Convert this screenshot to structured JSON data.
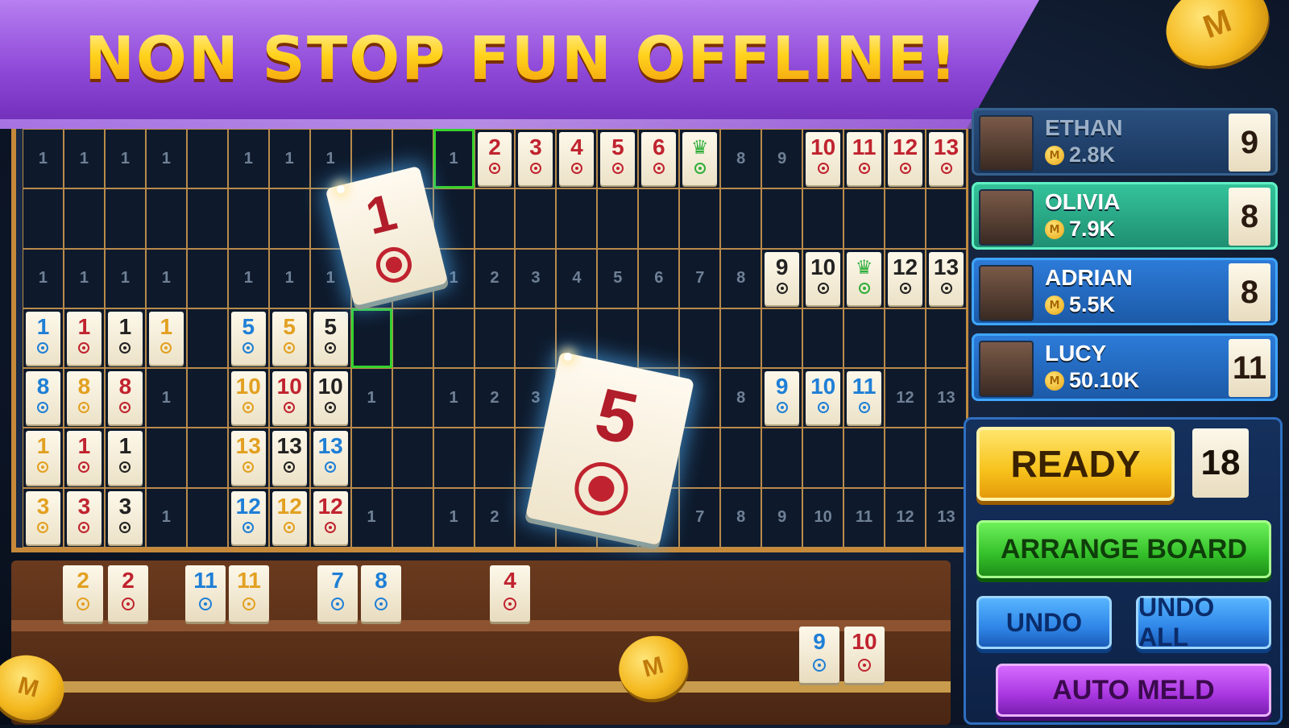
{
  "banner": {
    "title": "NON STOP FUN OFFLINE!"
  },
  "board": {
    "rows": [
      [
        {
          "n": "1",
          "t": "h"
        },
        {
          "n": "1",
          "t": "h"
        },
        {
          "n": "1",
          "t": "h"
        },
        {
          "n": "1",
          "t": "h"
        },
        {
          "n": "",
          "t": "e"
        },
        {
          "n": "1",
          "t": "h"
        },
        {
          "n": "1",
          "t": "h"
        },
        {
          "n": "1",
          "t": "h"
        },
        {
          "n": "",
          "t": "e"
        },
        {
          "n": "",
          "t": "e"
        },
        {
          "n": "1",
          "t": "h",
          "slot": true
        },
        {
          "n": "2",
          "t": "tile",
          "c": "red"
        },
        {
          "n": "3",
          "t": "tile",
          "c": "red"
        },
        {
          "n": "4",
          "t": "tile",
          "c": "red"
        },
        {
          "n": "5",
          "t": "tile",
          "c": "red"
        },
        {
          "n": "6",
          "t": "tile",
          "c": "red"
        },
        {
          "n": "joker",
          "t": "joker",
          "c": "green"
        },
        {
          "n": "8",
          "t": "h"
        },
        {
          "n": "9",
          "t": "h"
        },
        {
          "n": "10",
          "t": "tile",
          "c": "red"
        },
        {
          "n": "11",
          "t": "tile",
          "c": "red"
        },
        {
          "n": "12",
          "t": "tile",
          "c": "red"
        },
        {
          "n": "13",
          "t": "tile",
          "c": "red"
        }
      ],
      [
        {
          "n": "",
          "t": "e"
        },
        {
          "n": "",
          "t": "e"
        },
        {
          "n": "",
          "t": "e"
        },
        {
          "n": "",
          "t": "e"
        },
        {
          "n": "",
          "t": "e"
        },
        {
          "n": "",
          "t": "e"
        },
        {
          "n": "",
          "t": "e"
        },
        {
          "n": "",
          "t": "e"
        },
        {
          "n": "",
          "t": "e"
        },
        {
          "n": "",
          "t": "e"
        },
        {
          "n": "",
          "t": "e"
        },
        {
          "n": "",
          "t": "e"
        },
        {
          "n": "",
          "t": "e"
        },
        {
          "n": "",
          "t": "e"
        },
        {
          "n": "",
          "t": "e"
        },
        {
          "n": "",
          "t": "e"
        },
        {
          "n": "",
          "t": "e"
        },
        {
          "n": "",
          "t": "e"
        },
        {
          "n": "",
          "t": "e"
        },
        {
          "n": "",
          "t": "e"
        },
        {
          "n": "",
          "t": "e"
        },
        {
          "n": "",
          "t": "e"
        },
        {
          "n": "",
          "t": "e"
        }
      ],
      [
        {
          "n": "1",
          "t": "h"
        },
        {
          "n": "1",
          "t": "h"
        },
        {
          "n": "1",
          "t": "h"
        },
        {
          "n": "1",
          "t": "h"
        },
        {
          "n": "",
          "t": "e"
        },
        {
          "n": "1",
          "t": "h"
        },
        {
          "n": "1",
          "t": "h"
        },
        {
          "n": "1",
          "t": "h"
        },
        {
          "n": "",
          "t": "e"
        },
        {
          "n": "",
          "t": "e"
        },
        {
          "n": "1",
          "t": "h"
        },
        {
          "n": "2",
          "t": "h"
        },
        {
          "n": "3",
          "t": "h"
        },
        {
          "n": "4",
          "t": "h"
        },
        {
          "n": "5",
          "t": "h"
        },
        {
          "n": "6",
          "t": "h"
        },
        {
          "n": "7",
          "t": "h"
        },
        {
          "n": "8",
          "t": "h"
        },
        {
          "n": "9",
          "t": "tile",
          "c": "black"
        },
        {
          "n": "10",
          "t": "tile",
          "c": "black"
        },
        {
          "n": "joker",
          "t": "joker",
          "c": "green"
        },
        {
          "n": "12",
          "t": "tile",
          "c": "black"
        },
        {
          "n": "13",
          "t": "tile",
          "c": "black"
        }
      ],
      [
        {
          "n": "1",
          "t": "tile",
          "c": "blue"
        },
        {
          "n": "1",
          "t": "tile",
          "c": "red"
        },
        {
          "n": "1",
          "t": "tile",
          "c": "black"
        },
        {
          "n": "1",
          "t": "tile",
          "c": "yellow"
        },
        {
          "n": "",
          "t": "e"
        },
        {
          "n": "5",
          "t": "tile",
          "c": "blue"
        },
        {
          "n": "5",
          "t": "tile",
          "c": "yellow"
        },
        {
          "n": "5",
          "t": "tile",
          "c": "black"
        },
        {
          "n": "",
          "t": "e",
          "slot": true
        },
        {
          "n": "",
          "t": "e"
        },
        {
          "n": "",
          "t": "e"
        },
        {
          "n": "",
          "t": "e"
        },
        {
          "n": "",
          "t": "e"
        },
        {
          "n": "",
          "t": "e"
        },
        {
          "n": "",
          "t": "e"
        },
        {
          "n": "",
          "t": "e"
        },
        {
          "n": "",
          "t": "e"
        },
        {
          "n": "",
          "t": "e"
        },
        {
          "n": "",
          "t": "e"
        },
        {
          "n": "",
          "t": "e"
        },
        {
          "n": "",
          "t": "e"
        },
        {
          "n": "",
          "t": "e"
        },
        {
          "n": "",
          "t": "e"
        }
      ],
      [
        {
          "n": "8",
          "t": "tile",
          "c": "blue"
        },
        {
          "n": "8",
          "t": "tile",
          "c": "yellow"
        },
        {
          "n": "8",
          "t": "tile",
          "c": "red"
        },
        {
          "n": "1",
          "t": "h"
        },
        {
          "n": "",
          "t": "e"
        },
        {
          "n": "10",
          "t": "tile",
          "c": "yellow"
        },
        {
          "n": "10",
          "t": "tile",
          "c": "red"
        },
        {
          "n": "10",
          "t": "tile",
          "c": "black"
        },
        {
          "n": "1",
          "t": "h"
        },
        {
          "n": "",
          "t": "e"
        },
        {
          "n": "1",
          "t": "h"
        },
        {
          "n": "2",
          "t": "h"
        },
        {
          "n": "3",
          "t": "h"
        },
        {
          "n": "",
          "t": "e"
        },
        {
          "n": "",
          "t": "e"
        },
        {
          "n": "",
          "t": "e"
        },
        {
          "n": "",
          "t": "e"
        },
        {
          "n": "8",
          "t": "h"
        },
        {
          "n": "9",
          "t": "tile",
          "c": "blue"
        },
        {
          "n": "10",
          "t": "tile",
          "c": "blue"
        },
        {
          "n": "11",
          "t": "tile",
          "c": "blue"
        },
        {
          "n": "12",
          "t": "h"
        },
        {
          "n": "13",
          "t": "h"
        }
      ],
      [
        {
          "n": "1",
          "t": "tile",
          "c": "yellow"
        },
        {
          "n": "1",
          "t": "tile",
          "c": "red"
        },
        {
          "n": "1",
          "t": "tile",
          "c": "black"
        },
        {
          "n": "",
          "t": "e"
        },
        {
          "n": "",
          "t": "e"
        },
        {
          "n": "13",
          "t": "tile",
          "c": "yellow"
        },
        {
          "n": "13",
          "t": "tile",
          "c": "black"
        },
        {
          "n": "13",
          "t": "tile",
          "c": "blue"
        },
        {
          "n": "",
          "t": "e"
        },
        {
          "n": "",
          "t": "e"
        },
        {
          "n": "",
          "t": "e"
        },
        {
          "n": "",
          "t": "e"
        },
        {
          "n": "",
          "t": "e"
        },
        {
          "n": "",
          "t": "e"
        },
        {
          "n": "",
          "t": "e"
        },
        {
          "n": "",
          "t": "e"
        },
        {
          "n": "",
          "t": "e"
        },
        {
          "n": "",
          "t": "e"
        },
        {
          "n": "",
          "t": "e"
        },
        {
          "n": "",
          "t": "e"
        },
        {
          "n": "",
          "t": "e"
        },
        {
          "n": "",
          "t": "e"
        },
        {
          "n": "",
          "t": "e"
        }
      ],
      [
        {
          "n": "3",
          "t": "tile",
          "c": "yellow"
        },
        {
          "n": "3",
          "t": "tile",
          "c": "red"
        },
        {
          "n": "3",
          "t": "tile",
          "c": "black"
        },
        {
          "n": "1",
          "t": "h"
        },
        {
          "n": "",
          "t": "e"
        },
        {
          "n": "12",
          "t": "tile",
          "c": "blue"
        },
        {
          "n": "12",
          "t": "tile",
          "c": "yellow"
        },
        {
          "n": "12",
          "t": "tile",
          "c": "red"
        },
        {
          "n": "1",
          "t": "h"
        },
        {
          "n": "",
          "t": "e"
        },
        {
          "n": "1",
          "t": "h"
        },
        {
          "n": "2",
          "t": "h"
        },
        {
          "n": "3",
          "t": "h"
        },
        {
          "n": "",
          "t": "e"
        },
        {
          "n": "",
          "t": "e"
        },
        {
          "n": "",
          "t": "e"
        },
        {
          "n": "7",
          "t": "h"
        },
        {
          "n": "8",
          "t": "h"
        },
        {
          "n": "9",
          "t": "h"
        },
        {
          "n": "10",
          "t": "h"
        },
        {
          "n": "11",
          "t": "h"
        },
        {
          "n": "12",
          "t": "h"
        },
        {
          "n": "13",
          "t": "h"
        }
      ]
    ]
  },
  "floating": {
    "tile1": "1",
    "tile2": "5"
  },
  "rack": {
    "tiles": [
      {
        "n": "2",
        "c": "yellow"
      },
      {
        "n": "2",
        "c": "red"
      },
      {
        "n": "11",
        "c": "blue"
      },
      {
        "n": "11",
        "c": "yellow"
      },
      {
        "n": "7",
        "c": "blue"
      },
      {
        "n": "8",
        "c": "blue"
      },
      {
        "n": "4",
        "c": "red"
      },
      {
        "n": "9",
        "c": "blue"
      },
      {
        "n": "10",
        "c": "red"
      }
    ]
  },
  "players": [
    {
      "name": "ETHAN",
      "coins": "2.8K",
      "count": "9"
    },
    {
      "name": "OLIVIA",
      "coins": "7.9K",
      "count": "8"
    },
    {
      "name": "ADRIAN",
      "coins": "5.5K",
      "count": "8"
    },
    {
      "name": "LUCY",
      "coins": "50.10K",
      "count": "11"
    }
  ],
  "controls": {
    "ready": "READY",
    "ready_count": "18",
    "arrange": "ARRANGE BOARD",
    "undo": "UNDO",
    "undo_all": "UNDO ALL",
    "auto_meld": "AUTO MELD"
  },
  "colors": {
    "red": "#c0232f",
    "blue": "#1f7fd6",
    "yellow": "#e2a021",
    "black": "#222222",
    "green": "#2fae3a"
  }
}
